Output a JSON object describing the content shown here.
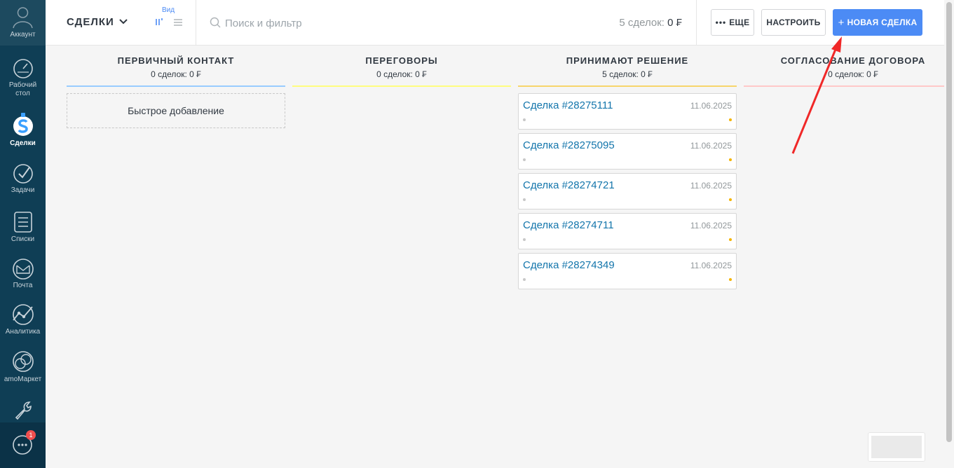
{
  "sidebar": {
    "account_label": "Аккаунт",
    "items": [
      {
        "label": "Рабочий\nстол",
        "icon": "dashboard-icon"
      },
      {
        "label": "Сделки",
        "icon": "leads-icon",
        "active": true
      },
      {
        "label": "Задачи",
        "icon": "tasks-icon"
      },
      {
        "label": "Списки",
        "icon": "lists-icon"
      },
      {
        "label": "Почта",
        "icon": "mail-icon"
      },
      {
        "label": "Аналитика",
        "icon": "analytics-icon"
      },
      {
        "label": "amoМаркет",
        "icon": "market-icon"
      },
      {
        "label": "",
        "icon": "settings-wrench-icon"
      }
    ],
    "chat_badge": "1"
  },
  "topbar": {
    "title": "СДЕЛКИ",
    "view_label": "Вид",
    "search_placeholder": "Поиск и фильтр",
    "count_text": "5 сделок:",
    "count_sum": "0 ₣",
    "more_label": "ЕЩЕ",
    "setup_label": "НАСТРОИТЬ",
    "new_deal_label": "НОВАЯ СДЕЛКА"
  },
  "columns": [
    {
      "name": "ПЕРВИЧНЫЙ КОНТАКТ",
      "stats": "0 сделок: 0 ₣",
      "color": "#99ccff",
      "quick_add": "Быстрое добавление"
    },
    {
      "name": "ПЕРЕГОВОРЫ",
      "stats": "0 сделок: 0 ₣",
      "color": "#fffd7f"
    },
    {
      "name": "ПРИНИМАЮТ РЕШЕНИЕ",
      "stats": "5 сделок: 0 ₣",
      "color": "#fff000"
    },
    {
      "name": "СОГЛАСОВАНИЕ ДОГОВОРА",
      "stats": "0 сделок: 0 ₣",
      "color": "#ffc8c8"
    }
  ],
  "deals": [
    {
      "name": "Сделка #28275111",
      "date": "11.06.2025"
    },
    {
      "name": "Сделка #28275095",
      "date": "11.06.2025"
    },
    {
      "name": "Сделка #28274721",
      "date": "11.06.2025"
    },
    {
      "name": "Сделка #28274711",
      "date": "11.06.2025"
    },
    {
      "name": "Сделка #28274349",
      "date": "11.06.2025"
    }
  ],
  "colors": {
    "sidebar_bg": "#0f3e55",
    "primary_button": "#4c8bf5",
    "deal_link": "#1375ab",
    "annotation_arrow": "#f02828"
  }
}
